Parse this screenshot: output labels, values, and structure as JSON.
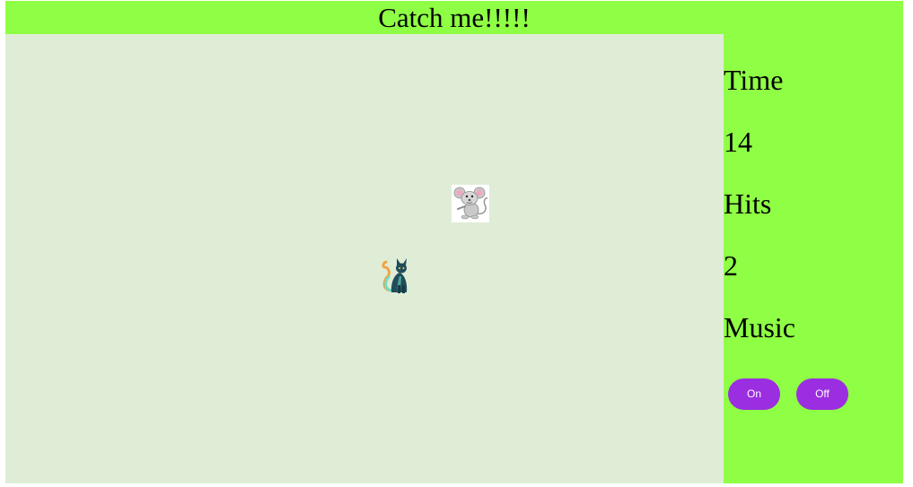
{
  "title": "Catch me!!!!!",
  "stats": {
    "time_label": "Time",
    "time_value": "14",
    "hits_label": "Hits",
    "hits_value": "2",
    "music_label": "Music"
  },
  "music_controls": {
    "on_label": "On",
    "off_label": "Off"
  },
  "sprites": {
    "mouse_icon": "mouse-sprite",
    "cat_icon": "cat-sprite"
  },
  "colors": {
    "header_panel_bg": "#8fff45",
    "field_bg": "#e0edd6",
    "button_bg": "#9a2ee0",
    "button_text": "#ffffff"
  }
}
